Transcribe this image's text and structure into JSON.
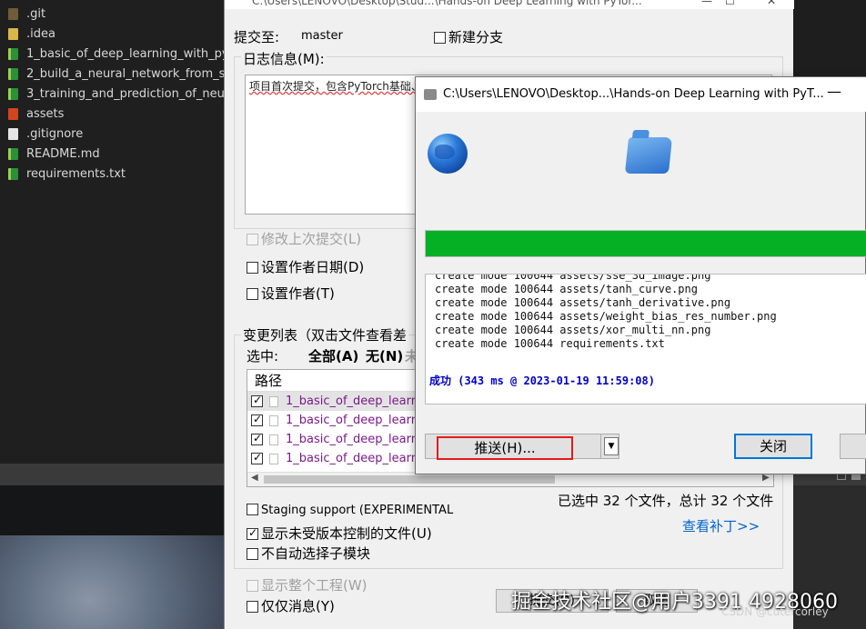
{
  "explorer": {
    "items": [
      {
        "label": ".git",
        "icon": "folder-icon"
      },
      {
        "label": ".idea",
        "icon": "folder-icon"
      },
      {
        "label": "1_basic_of_deep_learning_with_pyto",
        "icon": "notebook-icon"
      },
      {
        "label": "2_build_a_neural_network_from_scr",
        "icon": "notebook-icon"
      },
      {
        "label": "3_training_and_prediction_of_neura",
        "icon": "notebook-icon"
      },
      {
        "label": "assets",
        "icon": "folder-icon"
      },
      {
        "label": ".gitignore",
        "icon": "file-icon"
      },
      {
        "label": "README.md",
        "icon": "markdown-icon"
      },
      {
        "label": "requirements.txt",
        "icon": "text-file-icon"
      }
    ]
  },
  "commit_dialog": {
    "title": "C:\\Users\\LENOVO\\Desktop\\Stud...\\Hands-on Deep Learning with PyTor...",
    "commit_to_label": "提交至:",
    "branch": "master",
    "new_branch_label": "新建分支",
    "message_label": "日志信息(M):",
    "message_text": "项目首次提交，包含PyTorch基础、从0搭建神经网络和神经网络的训练与预测",
    "amend_label": "修改上次提交(L)",
    "set_author_date_label": "设置作者日期(D)",
    "set_author_label": "设置作者(T)",
    "changes_label": "变更列表（双击文件查看差",
    "select_label": "选中:",
    "select_all": "全部(A)",
    "select_none": "无(N)",
    "select_more": "未",
    "path_header": "路径",
    "files": [
      "1_basic_of_deep_learning",
      "1_basic_of_deep_learning",
      "1_basic_of_deep_learning",
      "1_basic_of_deep_learning"
    ],
    "summary": "已选中 32 个文件，总计 32 个文件",
    "view_patch_link": "查看补丁>>",
    "staging_label": "Staging support (EXPERIMENTAL",
    "show_unversioned_label": "显示未受版本控制的文件(U)",
    "no_auto_submodules_label": "不自动选择子模块",
    "show_whole_project_label": "显示整个工程(W)",
    "message_only_label": "仅仅消息(Y)",
    "commit_button": "提交(O)",
    "cancel_button": "取消"
  },
  "push_dialog": {
    "title": "C:\\Users\\LENOVO\\Desktop...\\Hands-on Deep Learning with PyT...",
    "minimize": "—",
    "progress_percent": 100,
    "progress_color": "#06b025",
    "log_lines": [
      "create mode 100644 assets/sse_3d_image.png",
      "create mode 100644 assets/tanh_curve.png",
      "create mode 100644 assets/tanh_derivative.png",
      "create mode 100644 assets/weight_bias_res_number.png",
      "create mode 100644 assets/xor_multi_nn.png",
      "create mode 100644 requirements.txt"
    ],
    "success_text": "成功 (343 ms @ 2023-01-19 11:59:08)",
    "push_button": "推送(H)...",
    "close_button": "关闭"
  },
  "watermark": {
    "main": "掘金技术社区@用户3391 4928060",
    "sub": "CSDN @cutercorley"
  }
}
